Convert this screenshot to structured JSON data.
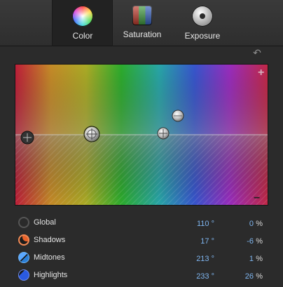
{
  "toolbar": {
    "tabs": [
      {
        "label": "Color",
        "active": true,
        "icon": "color-wheel-icon"
      },
      {
        "label": "Saturation",
        "active": false,
        "icon": "saturation-bars-icon"
      },
      {
        "label": "Exposure",
        "active": false,
        "icon": "exposure-dial-icon"
      }
    ]
  },
  "board": {
    "plus": "+",
    "minus": "−",
    "reset_icon": "undo-arrow-icon"
  },
  "controls": [
    {
      "label": "Global",
      "hue": "110 °",
      "amount": "0",
      "unit": "%",
      "icon": "global-puck-icon",
      "color": "#333333"
    },
    {
      "label": "Shadows",
      "hue": "17 °",
      "amount": "-6",
      "unit": "%",
      "icon": "shadows-puck-icon",
      "color": "#e8622a"
    },
    {
      "label": "Midtones",
      "hue": "213 °",
      "amount": "1",
      "unit": "%",
      "icon": "midtones-puck-icon",
      "color": "#2a7fd8"
    },
    {
      "label": "Highlights",
      "hue": "233 °",
      "amount": "26",
      "unit": "%",
      "icon": "highlights-puck-icon",
      "color": "#2a5ae0"
    }
  ]
}
